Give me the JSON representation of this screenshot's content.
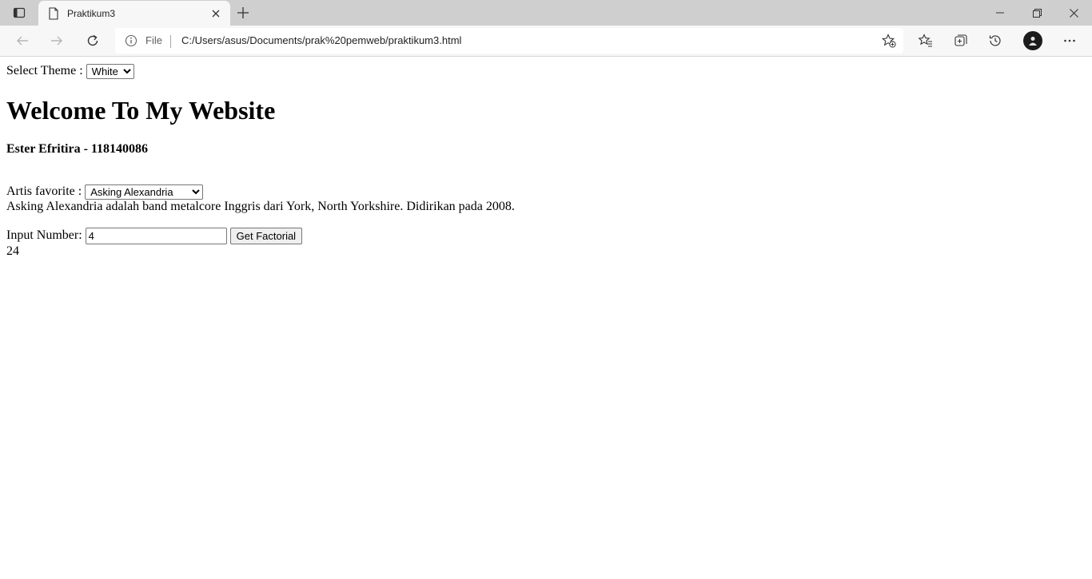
{
  "browser": {
    "tab": {
      "title": "Praktikum3"
    },
    "address": {
      "scheme_label": "File",
      "url": "C:/Users/asus/Documents/prak%20pemweb/praktikum3.html"
    },
    "icons": {
      "tab_actions": "tab-actions-icon",
      "page": "page-icon",
      "close": "close-icon",
      "new_tab": "plus-icon",
      "back": "back-arrow-icon",
      "forward": "forward-arrow-icon",
      "refresh": "refresh-icon",
      "info": "info-icon",
      "add_favorite": "star-plus-icon",
      "favorites": "favorites-icon",
      "collections": "collections-icon",
      "history": "history-icon",
      "profile": "avatar",
      "more": "more-icon"
    }
  },
  "page": {
    "theme": {
      "label": "Select Theme :",
      "selected": "White"
    },
    "title": "Welcome To My Website",
    "author": "Ester Efritira - 118140086",
    "artist": {
      "label": "Artis favorite :",
      "selected": "Asking Alexandria",
      "description": "Asking Alexandria adalah band metalcore Inggris dari York, North Yorkshire. Didirikan pada 2008."
    },
    "factorial": {
      "label": "Input Number:",
      "input_value": "4",
      "button_label": "Get Factorial",
      "result": "24"
    }
  }
}
